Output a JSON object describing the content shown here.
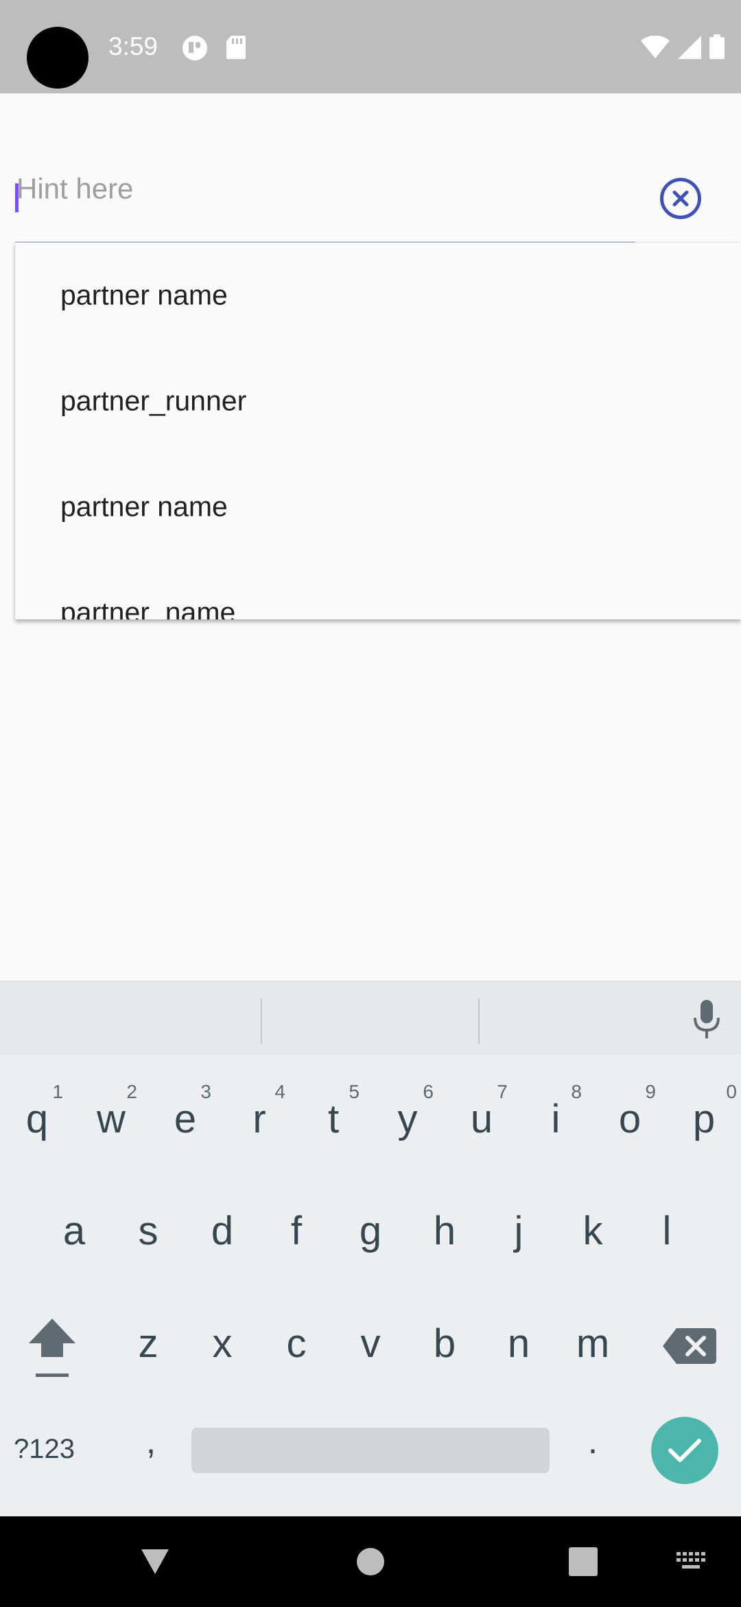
{
  "status_bar": {
    "time": "3:59",
    "icons": [
      "camera-cutout",
      "sync-icon",
      "sd-card-icon",
      "wifi-icon",
      "signal-icon",
      "battery-icon"
    ]
  },
  "search": {
    "placeholder": "Hint here",
    "value": "",
    "clear_icon": "close-circle-icon",
    "accent_color": "#3f51b5",
    "cursor_color": "#7c4dff"
  },
  "suggestions": [
    {
      "label": "partner name"
    },
    {
      "label": "partner_runner"
    },
    {
      "label": "partner name"
    },
    {
      "label": "partner_name"
    }
  ],
  "keyboard": {
    "row1": [
      {
        "key": "q",
        "hint": "1"
      },
      {
        "key": "w",
        "hint": "2"
      },
      {
        "key": "e",
        "hint": "3"
      },
      {
        "key": "r",
        "hint": "4"
      },
      {
        "key": "t",
        "hint": "5"
      },
      {
        "key": "y",
        "hint": "6"
      },
      {
        "key": "u",
        "hint": "7"
      },
      {
        "key": "i",
        "hint": "8"
      },
      {
        "key": "o",
        "hint": "9"
      },
      {
        "key": "p",
        "hint": "0"
      }
    ],
    "row2": [
      "a",
      "s",
      "d",
      "f",
      "g",
      "h",
      "j",
      "k",
      "l"
    ],
    "row3": [
      "z",
      "x",
      "c",
      "v",
      "b",
      "n",
      "m"
    ],
    "symbols_label": "?123",
    "comma": ",",
    "period": ".",
    "enter_color": "#4db6ac"
  },
  "nav": {
    "buttons": [
      "back-icon",
      "home-icon",
      "recents-icon",
      "keyboard-switch-icon"
    ]
  }
}
